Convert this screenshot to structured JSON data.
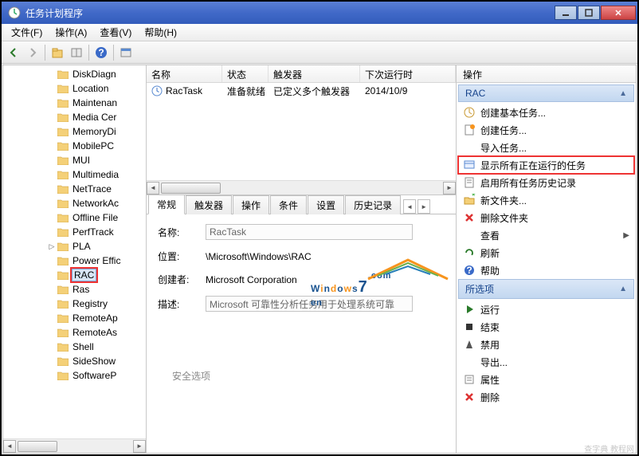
{
  "title": "任务计划程序",
  "menus": {
    "file": "文件(F)",
    "action": "操作(A)",
    "view": "查看(V)",
    "help": "帮助(H)"
  },
  "tree_items": [
    {
      "label": "DiskDiagn",
      "expand": false
    },
    {
      "label": "Location",
      "expand": false
    },
    {
      "label": "Maintenan",
      "expand": false
    },
    {
      "label": "Media Cer",
      "expand": false
    },
    {
      "label": "MemoryDi",
      "expand": false
    },
    {
      "label": "MobilePC",
      "expand": false
    },
    {
      "label": "MUI",
      "expand": false
    },
    {
      "label": "Multimedia",
      "expand": false
    },
    {
      "label": "NetTrace",
      "expand": false
    },
    {
      "label": "NetworkAc",
      "expand": false
    },
    {
      "label": "Offline File",
      "expand": false
    },
    {
      "label": "PerfTrack",
      "expand": false
    },
    {
      "label": "PLA",
      "expand": true
    },
    {
      "label": "Power Effic",
      "expand": false
    },
    {
      "label": "RAC",
      "expand": false,
      "highlight": true,
      "selected": true
    },
    {
      "label": "Ras",
      "expand": false
    },
    {
      "label": "Registry",
      "expand": false
    },
    {
      "label": "RemoteAp",
      "expand": false
    },
    {
      "label": "RemoteAs",
      "expand": false
    },
    {
      "label": "Shell",
      "expand": false
    },
    {
      "label": "SideShow",
      "expand": false
    },
    {
      "label": "SoftwareP",
      "expand": false
    }
  ],
  "task_list": {
    "headers": {
      "name": "名称",
      "status": "状态",
      "trigger": "触发器",
      "next": "下次运行时"
    },
    "rows": [
      {
        "name": "RacTask",
        "status": "准备就绪",
        "trigger": "已定义多个触发器",
        "next": "2014/10/9"
      }
    ]
  },
  "tabs": {
    "general": "常规",
    "trigger": "触发器",
    "action": "操作",
    "condition": "条件",
    "setting": "设置",
    "history": "历史记录"
  },
  "details": {
    "name_label": "名称:",
    "name_value": "RacTask",
    "loc_label": "位置:",
    "loc_value": "\\Microsoft\\Windows\\RAC",
    "creator_label": "创建者:",
    "creator_value": "Microsoft Corporation",
    "desc_label": "描述:",
    "desc_value": "Microsoft 可靠性分析任务用于处理系统可靠",
    "footer": "安全选项"
  },
  "actions_panel": {
    "header": "操作",
    "section1": "RAC",
    "items1": [
      {
        "icon": "wizard",
        "label": "创建基本任务..."
      },
      {
        "icon": "new",
        "label": "创建任务..."
      },
      {
        "icon": "none",
        "label": "导入任务..."
      },
      {
        "icon": "display",
        "label": "显示所有正在运行的任务",
        "highlight": true
      },
      {
        "icon": "history",
        "label": "启用所有任务历史记录"
      },
      {
        "icon": "folder",
        "label": "新文件夹..."
      },
      {
        "icon": "delete",
        "label": "删除文件夹"
      },
      {
        "icon": "none",
        "label": "查看",
        "submenu": true
      },
      {
        "icon": "refresh",
        "label": "刷新"
      },
      {
        "icon": "help",
        "label": "帮助"
      }
    ],
    "section2": "所选项",
    "items2": [
      {
        "icon": "play",
        "label": "运行"
      },
      {
        "icon": "stop",
        "label": "结束"
      },
      {
        "icon": "disable",
        "label": "禁用"
      },
      {
        "icon": "none",
        "label": "导出..."
      },
      {
        "icon": "props",
        "label": "属性"
      },
      {
        "icon": "delete",
        "label": "删除"
      }
    ]
  },
  "footer_credit": "查字典  教程网"
}
